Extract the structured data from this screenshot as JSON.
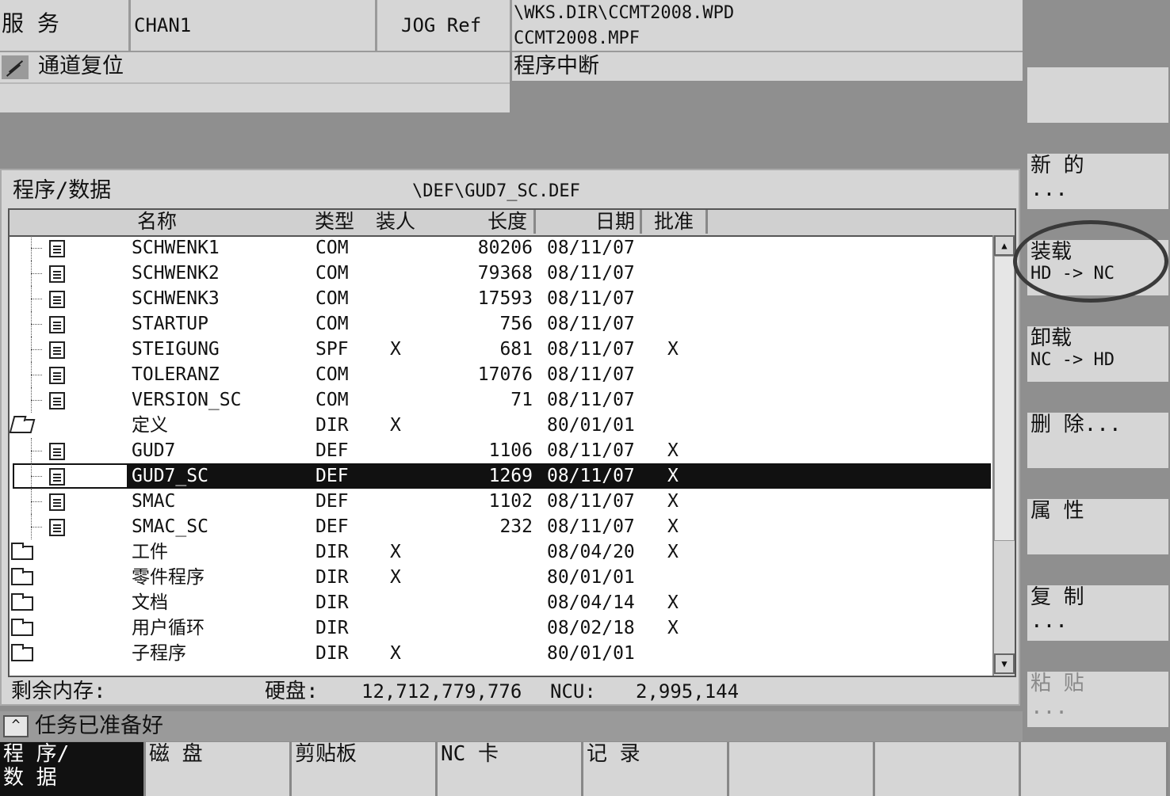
{
  "header": {
    "area": "服 务",
    "channel": "CHAN1",
    "mode": "JOG Ref",
    "path_line1": "\\WKS.DIR\\CCMT2008.WPD",
    "path_line2": "CCMT2008.MPF",
    "channel_status": "通道复位",
    "program_status": "程序中断"
  },
  "content": {
    "title": "程序/数据",
    "current_path": "\\DEF\\GUD7_SC.DEF",
    "columns": [
      "名称",
      "类型",
      "装人",
      "长度",
      "日期",
      "批准"
    ],
    "rows": [
      {
        "icon": "file",
        "name": "SCHWENK1",
        "type": "COM",
        "loaded": "",
        "length": "80206",
        "date": "08/11/07",
        "enabled": ""
      },
      {
        "icon": "file",
        "name": "SCHWENK2",
        "type": "COM",
        "loaded": "",
        "length": "79368",
        "date": "08/11/07",
        "enabled": ""
      },
      {
        "icon": "file",
        "name": "SCHWENK3",
        "type": "COM",
        "loaded": "",
        "length": "17593",
        "date": "08/11/07",
        "enabled": ""
      },
      {
        "icon": "file",
        "name": "STARTUP",
        "type": "COM",
        "loaded": "",
        "length": "756",
        "date": "08/11/07",
        "enabled": ""
      },
      {
        "icon": "file",
        "name": "STEIGUNG",
        "type": "SPF",
        "loaded": "X",
        "length": "681",
        "date": "08/11/07",
        "enabled": "X"
      },
      {
        "icon": "file",
        "name": "TOLERANZ",
        "type": "COM",
        "loaded": "",
        "length": "17076",
        "date": "08/11/07",
        "enabled": ""
      },
      {
        "icon": "file",
        "name": "VERSION_SC",
        "type": "COM",
        "loaded": "",
        "length": "71",
        "date": "08/11/07",
        "enabled": ""
      },
      {
        "icon": "folder-open",
        "name": "定义",
        "type": "DIR",
        "loaded": "X",
        "length": "",
        "date": "80/01/01",
        "enabled": ""
      },
      {
        "icon": "file",
        "name": "GUD7",
        "type": "DEF",
        "loaded": "",
        "length": "1106",
        "date": "08/11/07",
        "enabled": "X"
      },
      {
        "icon": "file-selected",
        "name": "GUD7_SC",
        "type": "DEF",
        "loaded": "",
        "length": "1269",
        "date": "08/11/07",
        "enabled": "X",
        "selected": true
      },
      {
        "icon": "file",
        "name": "SMAC",
        "type": "DEF",
        "loaded": "",
        "length": "1102",
        "date": "08/11/07",
        "enabled": "X"
      },
      {
        "icon": "file",
        "name": "SMAC_SC",
        "type": "DEF",
        "loaded": "",
        "length": "232",
        "date": "08/11/07",
        "enabled": "X"
      },
      {
        "icon": "folder",
        "name": "工件",
        "type": "DIR",
        "loaded": "X",
        "length": "",
        "date": "08/04/20",
        "enabled": "X"
      },
      {
        "icon": "folder",
        "name": "零件程序",
        "type": "DIR",
        "loaded": "X",
        "length": "",
        "date": "80/01/01",
        "enabled": ""
      },
      {
        "icon": "folder",
        "name": "文档",
        "type": "DIR",
        "loaded": "",
        "length": "",
        "date": "08/04/14",
        "enabled": "X"
      },
      {
        "icon": "folder",
        "name": "用户循环",
        "type": "DIR",
        "loaded": "",
        "length": "",
        "date": "08/02/18",
        "enabled": "X"
      },
      {
        "icon": "folder",
        "name": "子程序",
        "type": "DIR",
        "loaded": "X",
        "length": "",
        "date": "80/01/01",
        "enabled": ""
      }
    ],
    "memory": {
      "label": "剩余内存:",
      "hd_label": "硬盘:",
      "hd_value": "12,712,779,776",
      "ncu_label": "NCU:",
      "ncu_value": "2,995,144"
    }
  },
  "message": "任务已准备好",
  "softkeys": {
    "sk1": {
      "l1": "",
      "l2": ""
    },
    "sk2": {
      "l1": "新 的",
      "l2": "..."
    },
    "sk3": {
      "l1": "装载",
      "l2": "HD -> NC"
    },
    "sk4": {
      "l1": "卸载",
      "l2": "NC -> HD"
    },
    "sk5": {
      "l1": "删 除...",
      "l2": ""
    },
    "sk6": {
      "l1": "属 性",
      "l2": ""
    },
    "sk7": {
      "l1": "复 制",
      "l2": "..."
    },
    "sk8": {
      "l1": "粘 贴",
      "l2": "..."
    }
  },
  "bottom_keys": [
    {
      "l1": "程 序/",
      "l2": "数 据"
    },
    {
      "l1": "磁 盘",
      "l2": ""
    },
    {
      "l1": "剪贴板",
      "l2": ""
    },
    {
      "l1": "NC 卡",
      "l2": ""
    },
    {
      "l1": "记 录",
      "l2": ""
    },
    {
      "l1": "",
      "l2": ""
    },
    {
      "l1": "",
      "l2": ""
    },
    {
      "l1": "",
      "l2": ""
    }
  ],
  "colors": {
    "panel": "#d6d6d6",
    "background": "#8f8f8f",
    "selected_row": "#111111",
    "active_bottom_key": "#111111"
  }
}
